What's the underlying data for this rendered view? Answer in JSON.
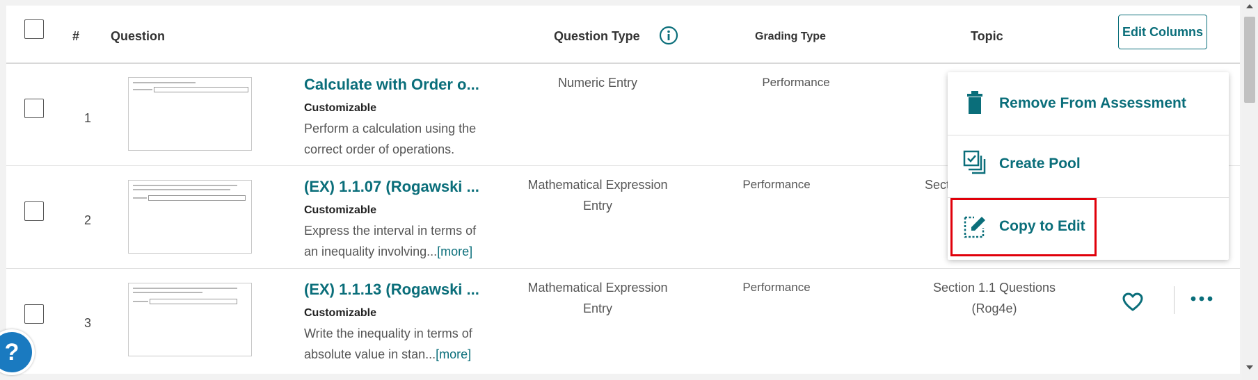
{
  "header": {
    "number_col": "#",
    "question_col": "Question",
    "question_type_col": "Question Type",
    "grading_type_col": "Grading Type",
    "topic_col": "Topic",
    "edit_columns": "Edit Columns"
  },
  "rows": [
    {
      "num": "1",
      "title": "Calculate with Order o...",
      "tag": "Customizable",
      "desc": "Perform a calculation using the correct order of operations.",
      "more": "",
      "type_line1": "Numeric Entry",
      "type_line2": "",
      "grading": "Performance",
      "topic_line1": "",
      "topic_line2": ""
    },
    {
      "num": "2",
      "title": "(EX) 1.1.07 (Rogawski ...",
      "tag": "Customizable",
      "desc": "Express the interval in terms of an inequality involving...",
      "more": "[more]",
      "type_line1": "Mathematical Expression",
      "type_line2": "Entry",
      "grading": "Performance",
      "topic_line1": "Secti",
      "topic_line2": ""
    },
    {
      "num": "3",
      "title": "(EX) 1.1.13 (Rogawski ...",
      "tag": "Customizable",
      "desc": "Write the inequality in terms of absolute value in stan...",
      "more": "[more]",
      "type_line1": "Mathematical Expression",
      "type_line2": "Entry",
      "grading": "Performance",
      "topic_line1": "Section 1.1 Questions",
      "topic_line2": "(Rog4e)"
    }
  ],
  "menu": {
    "items": [
      {
        "label": "Remove From Assessment",
        "icon": "trash-icon"
      },
      {
        "label": "Create Pool",
        "icon": "copy-pool-icon"
      },
      {
        "label": "Copy to Edit",
        "icon": "edit-copy-icon"
      }
    ]
  },
  "colors": {
    "accent": "#0a6e7a",
    "highlight": "#e0000a",
    "help": "#1a7ac0"
  },
  "help_glyph": "?"
}
